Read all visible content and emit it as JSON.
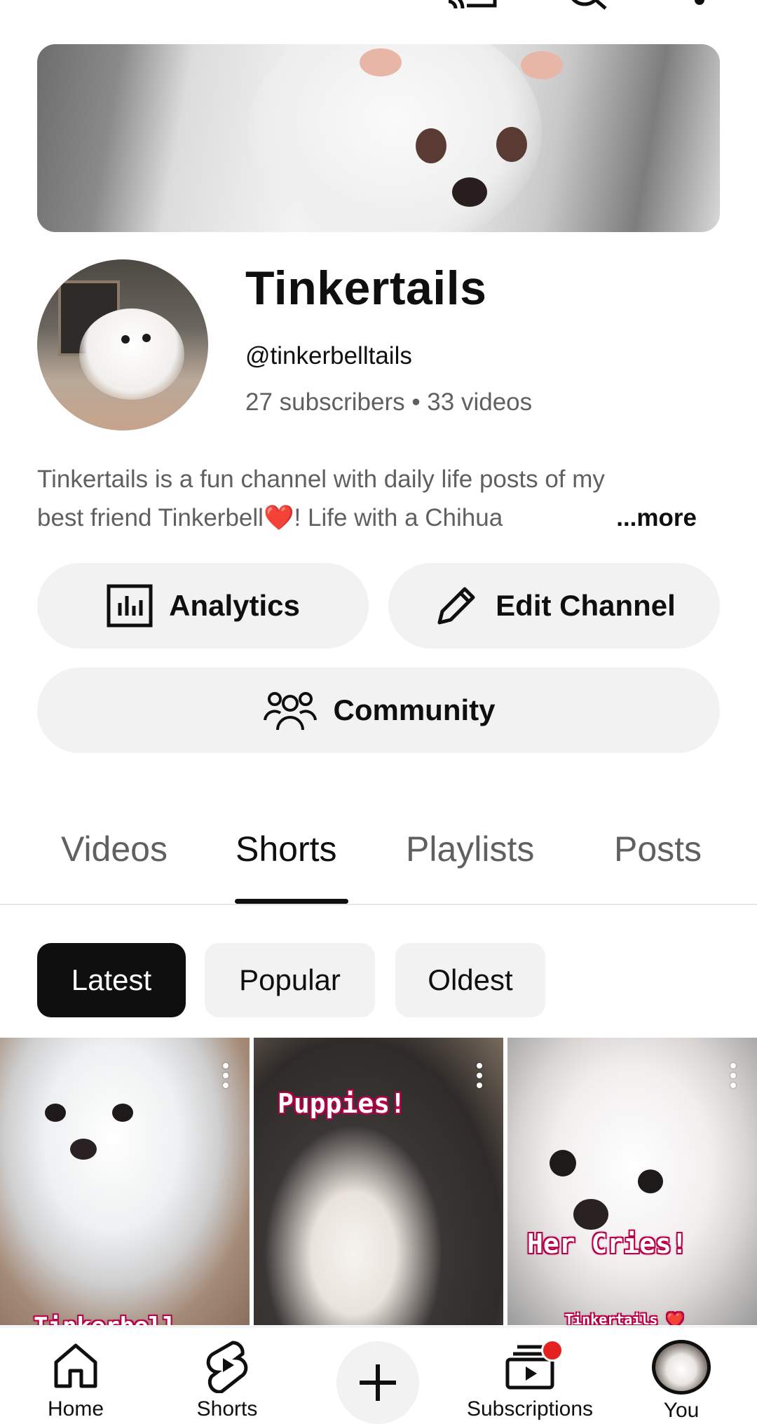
{
  "channel": {
    "name": "Tinkertails",
    "handle": "@tinkerbelltails",
    "stats": "27 subscribers • 33 videos",
    "description_line1": "Tinkertails is a fun channel with daily life posts of my",
    "description_line2": "best friend Tinkerbell❤️!  Life with a Chihua",
    "description_more": "...more"
  },
  "actions": {
    "analytics": "Analytics",
    "edit_channel": "Edit Channel",
    "community": "Community"
  },
  "tabs": [
    {
      "label": "Videos",
      "active": false
    },
    {
      "label": "Shorts",
      "active": true
    },
    {
      "label": "Playlists",
      "active": false
    },
    {
      "label": "Posts",
      "active": false
    }
  ],
  "chips": [
    {
      "label": "Latest",
      "active": true
    },
    {
      "label": "Popular",
      "active": false
    },
    {
      "label": "Oldest",
      "active": false
    }
  ],
  "shorts": [
    {
      "caption": "Tinkerbell"
    },
    {
      "caption": "Puppies!"
    },
    {
      "caption": "Her Cries!",
      "watermark": "Tinkertails ❤️"
    }
  ],
  "bottom_nav": [
    {
      "label": "Home",
      "icon": "home-icon"
    },
    {
      "label": "Shorts",
      "icon": "shorts-icon"
    },
    {
      "label": "",
      "icon": "plus-icon"
    },
    {
      "label": "Subscriptions",
      "icon": "subscriptions-icon",
      "badge": true
    },
    {
      "label": "You",
      "icon": "avatar"
    }
  ],
  "colors": {
    "text_primary": "#0f0f0f",
    "text_secondary": "#606060",
    "chip_bg": "#f2f2f2",
    "notification": "#e52020"
  }
}
